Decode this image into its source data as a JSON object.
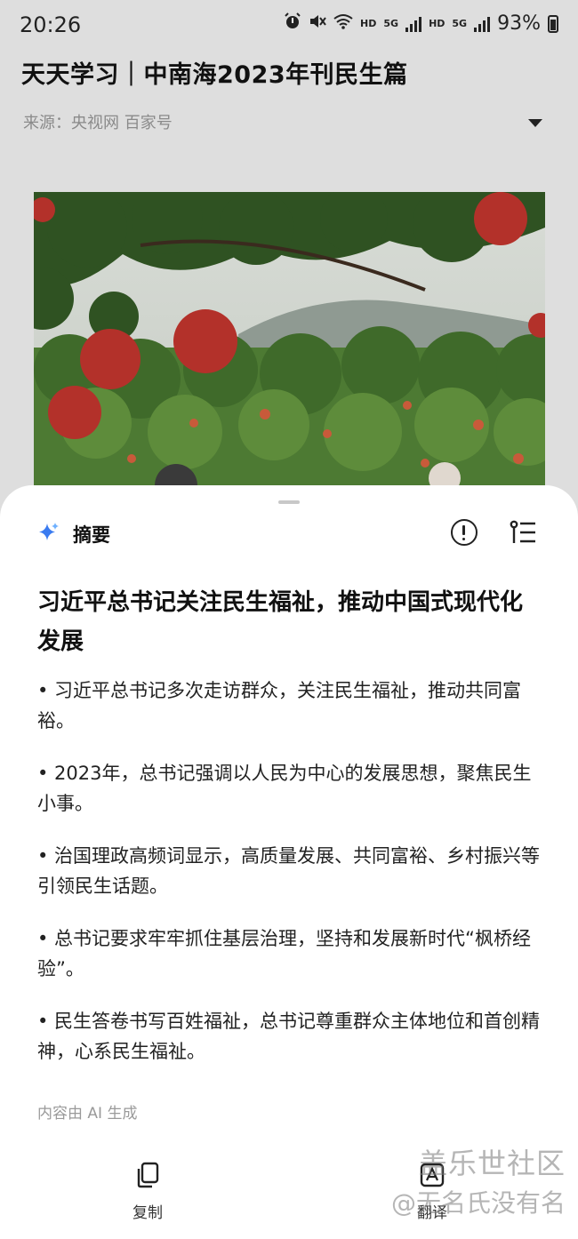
{
  "status_bar": {
    "time": "20:26",
    "hd1": "HD",
    "net1": "5G",
    "hd2": "HD",
    "net2": "5G",
    "battery_pct": "93%",
    "icons": [
      "alarm-icon",
      "mute-icon",
      "wifi-icon",
      "signal-icon",
      "battery-icon"
    ]
  },
  "article": {
    "title": "天天学习｜中南海2023年刊民生篇",
    "source": "来源：央视网 百家号"
  },
  "summary": {
    "heading": "摘要",
    "title": "习近平总书记关注民生福祉，推动中国式现代化发展",
    "bullets": [
      "• 习近平总书记多次走访群众，关注民生福祉，推动共同富裕。",
      "• 2023年，总书记强调以人民为中心的发展思想，聚焦民生小事。",
      "• 治国理政高频词显示，高质量发展、共同富裕、乡村振兴等引领民生话题。",
      "• 总书记要求牢牢抓住基层治理，坚持和发展新时代“枫桥经验”。",
      "• 民生答卷书写百姓福祉，总书记尊重群众主体地位和首创精神，心系民生福祉。"
    ],
    "ai_note": "内容由 AI 生成"
  },
  "actions": {
    "copy_label": "复制",
    "translate_label": "翻译"
  },
  "watermark": {
    "line1": "盖乐世社区",
    "line2": "@无名氏没有名"
  },
  "colors": {
    "background": "#dedede",
    "sheet": "#ffffff",
    "accent_sparkle": "#3a7bf0"
  }
}
